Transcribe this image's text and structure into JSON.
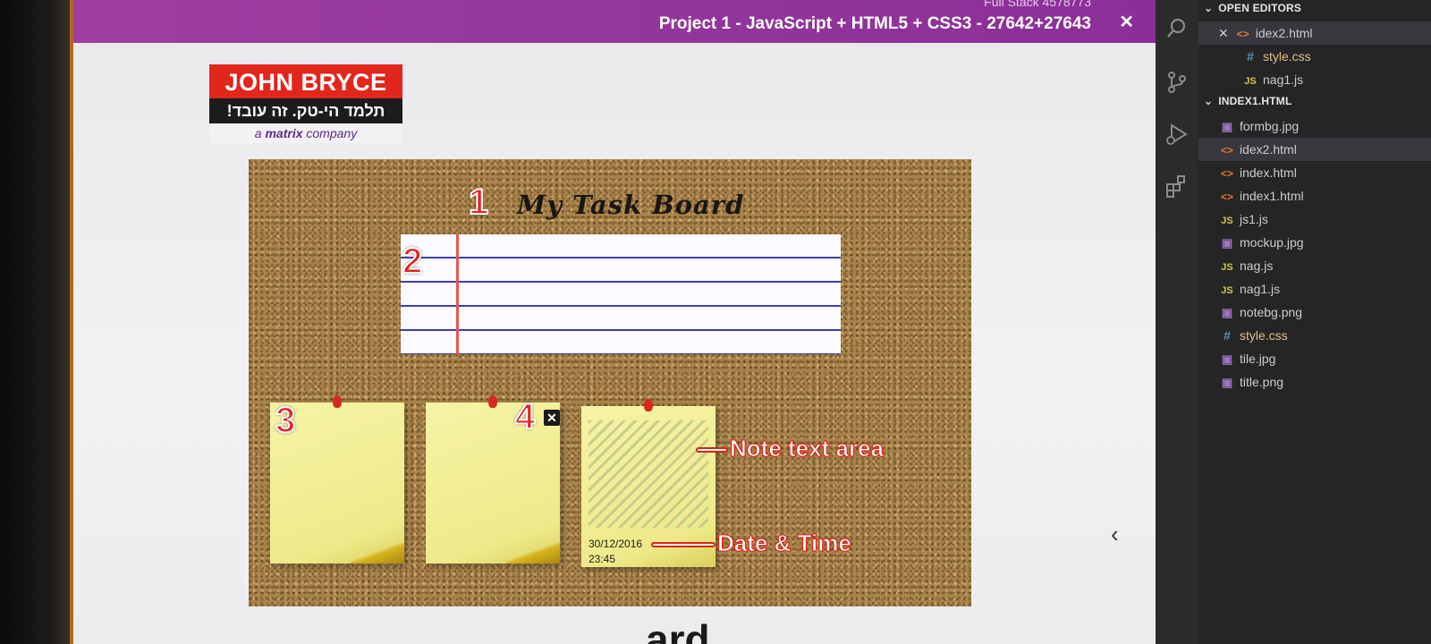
{
  "document": {
    "title_sub": "Full Stack 4578773",
    "title": "Project 1 - JavaScript + HTML5 + CSS3 - 27642+27643",
    "close_glyph": "✕",
    "footer_partial": "ard",
    "collapse_chevron": "‹"
  },
  "logo": {
    "brand": "JOHN BRYCE",
    "slogan": "תלמד הי-טק. זה עובד!",
    "tagline_prefix": "a ",
    "tagline_bold": "matrix",
    "tagline_suffix": " company"
  },
  "board": {
    "title": "My Task Board",
    "markers": [
      "1",
      "2",
      "3",
      "4"
    ],
    "note_date": "30/12/2016",
    "note_time": "23:45",
    "note_close_glyph": "✕",
    "callout_text_area": "Note text area",
    "callout_date_time": "Date & Time"
  },
  "activity_bar": {
    "icons": [
      "search-icon",
      "source-control-icon",
      "run-debug-icon",
      "extensions-icon"
    ]
  },
  "explorer": {
    "open_editors_label": "OPEN EDITORS",
    "open_editors": [
      {
        "name": "idex2.html",
        "type": "html",
        "closable": true,
        "active": true
      },
      {
        "name": "style.css",
        "type": "css",
        "modified": true
      },
      {
        "name": "nag1.js",
        "type": "js"
      }
    ],
    "folder_label": "INDEX1.HTML",
    "files": [
      {
        "name": "formbg.jpg",
        "type": "img"
      },
      {
        "name": "idex2.html",
        "type": "html",
        "active": true
      },
      {
        "name": "index.html",
        "type": "html"
      },
      {
        "name": "index1.html",
        "type": "html"
      },
      {
        "name": "js1.js",
        "type": "js"
      },
      {
        "name": "mockup.jpg",
        "type": "img"
      },
      {
        "name": "nag.js",
        "type": "js"
      },
      {
        "name": "nag1.js",
        "type": "js"
      },
      {
        "name": "notebg.png",
        "type": "img"
      },
      {
        "name": "style.css",
        "type": "css",
        "modified": true
      },
      {
        "name": "tile.jpg",
        "type": "img"
      },
      {
        "name": "title.png",
        "type": "img"
      }
    ]
  },
  "colors": {
    "title_bar": "#9d3fa0",
    "logo_red": "#e1261c",
    "marker_red": "#e52420",
    "note_yellow": "#f6f3a5",
    "vscode_sidebar": "#252526"
  }
}
